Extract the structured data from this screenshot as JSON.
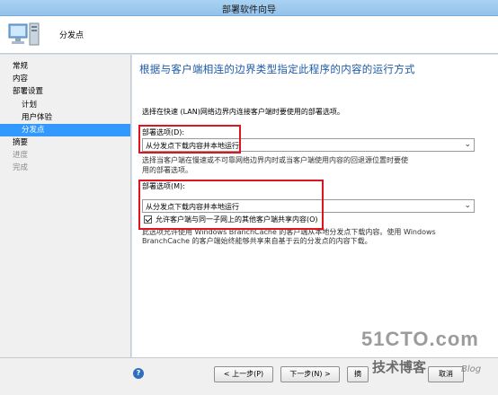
{
  "window": {
    "title": "部署软件向导"
  },
  "header": {
    "page_name": "分发点",
    "icon": "computer-icon"
  },
  "nav": {
    "items": [
      {
        "label": "常规",
        "state": "normal"
      },
      {
        "label": "内容",
        "state": "normal"
      },
      {
        "label": "部署设置",
        "state": "normal"
      },
      {
        "label": "计划",
        "state": "normal"
      },
      {
        "label": "用户体验",
        "state": "normal"
      },
      {
        "label": "分发点",
        "state": "selected"
      },
      {
        "label": "摘要",
        "state": "normal"
      },
      {
        "label": "进度",
        "state": "disabled"
      },
      {
        "label": "完成",
        "state": "disabled"
      }
    ]
  },
  "main": {
    "heading": "根据与客户端相连的边界类型指定此程序的内容的运行方式",
    "description": "选择在快速 (LAN)网络边界内连接客户端时要使用的部署选项。",
    "option1": {
      "label": "部署选项(D):",
      "selected": "从分发点下载内容并本地运行",
      "help": "选择当客户端在慢速或不可靠网络边界内时或当客户端使用内容的回退源位置时要使用的部署选项。"
    },
    "option2": {
      "label": "部署选项(M):",
      "selected": "从分发点下载内容并本地运行"
    },
    "checkbox": {
      "label": "允许客户端与同一子网上的其他客户端共享内容(O)",
      "checked": true
    },
    "branchcache_note": "此选项允许使用 Windows BranchCache 的客户端从本地分发点下载内容。使用 Windows BranchCache 的客户端始终能够共享来自基于云的分发点的内容下载。"
  },
  "footer": {
    "help_icon": "help-icon",
    "prev": "< 上一步(P)",
    "next": "下一步(N) >",
    "summary": "摘",
    "cancel": "取消"
  },
  "watermark": {
    "main": "51CTO.com",
    "sub": "技术博客",
    "blog": "Blog"
  },
  "colors": {
    "accent": "#3399ff",
    "heading": "#1e5aa8",
    "highlight_box": "#e0141e"
  }
}
